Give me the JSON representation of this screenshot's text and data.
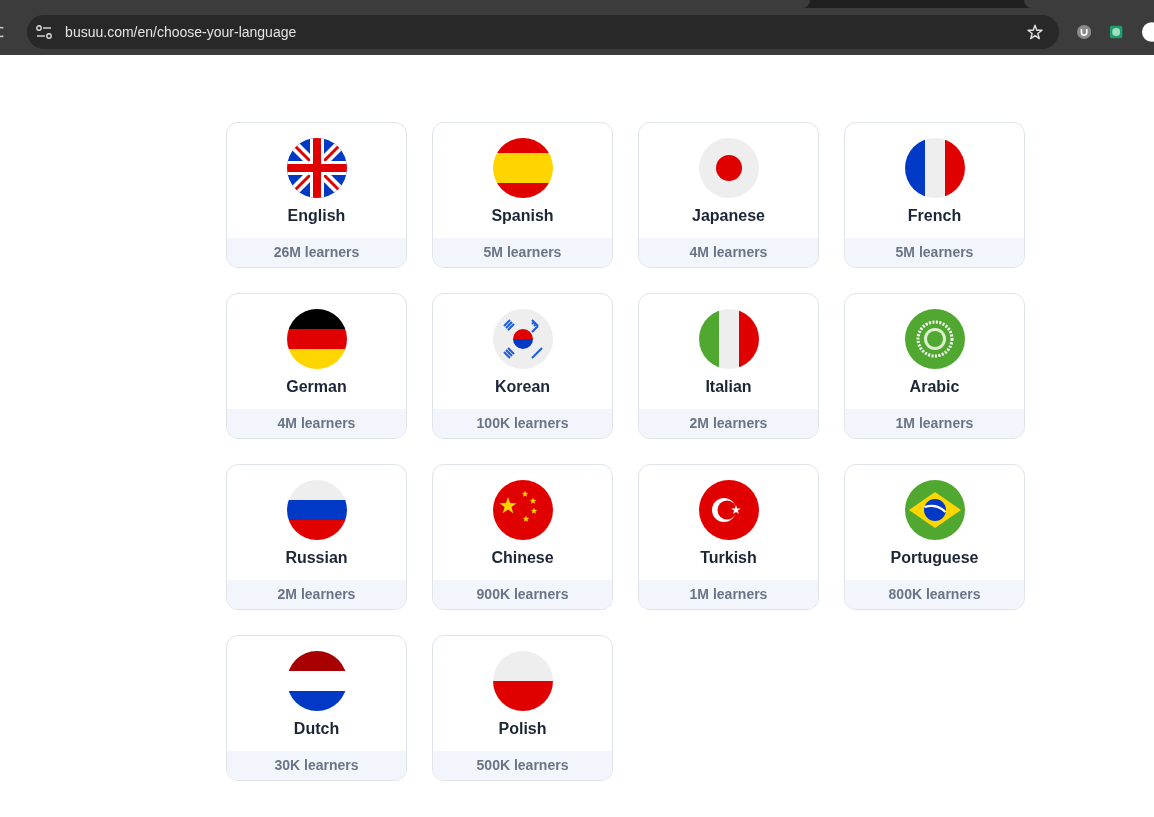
{
  "browser": {
    "url": "busuu.com/en/choose-your-language"
  },
  "languages": [
    {
      "kind": "uk",
      "name": "English",
      "learners": "26M learners"
    },
    {
      "kind": "spain",
      "name": "Spanish",
      "learners": "5M learners"
    },
    {
      "kind": "japan",
      "name": "Japanese",
      "learners": "4M learners"
    },
    {
      "kind": "france",
      "name": "French",
      "learners": "5M learners"
    },
    {
      "kind": "germany",
      "name": "German",
      "learners": "4M learners"
    },
    {
      "kind": "korea",
      "name": "Korean",
      "learners": "100K learners"
    },
    {
      "kind": "italy",
      "name": "Italian",
      "learners": "2M learners"
    },
    {
      "kind": "arab",
      "name": "Arabic",
      "learners": "1M learners"
    },
    {
      "kind": "russia",
      "name": "Russian",
      "learners": "2M learners"
    },
    {
      "kind": "china",
      "name": "Chinese",
      "learners": "900K learners"
    },
    {
      "kind": "turkey",
      "name": "Turkish",
      "learners": "1M learners"
    },
    {
      "kind": "brazil",
      "name": "Portuguese",
      "learners": "800K learners"
    },
    {
      "kind": "netherlands",
      "name": "Dutch",
      "learners": "30K learners"
    },
    {
      "kind": "poland",
      "name": "Polish",
      "learners": "500K learners"
    }
  ]
}
